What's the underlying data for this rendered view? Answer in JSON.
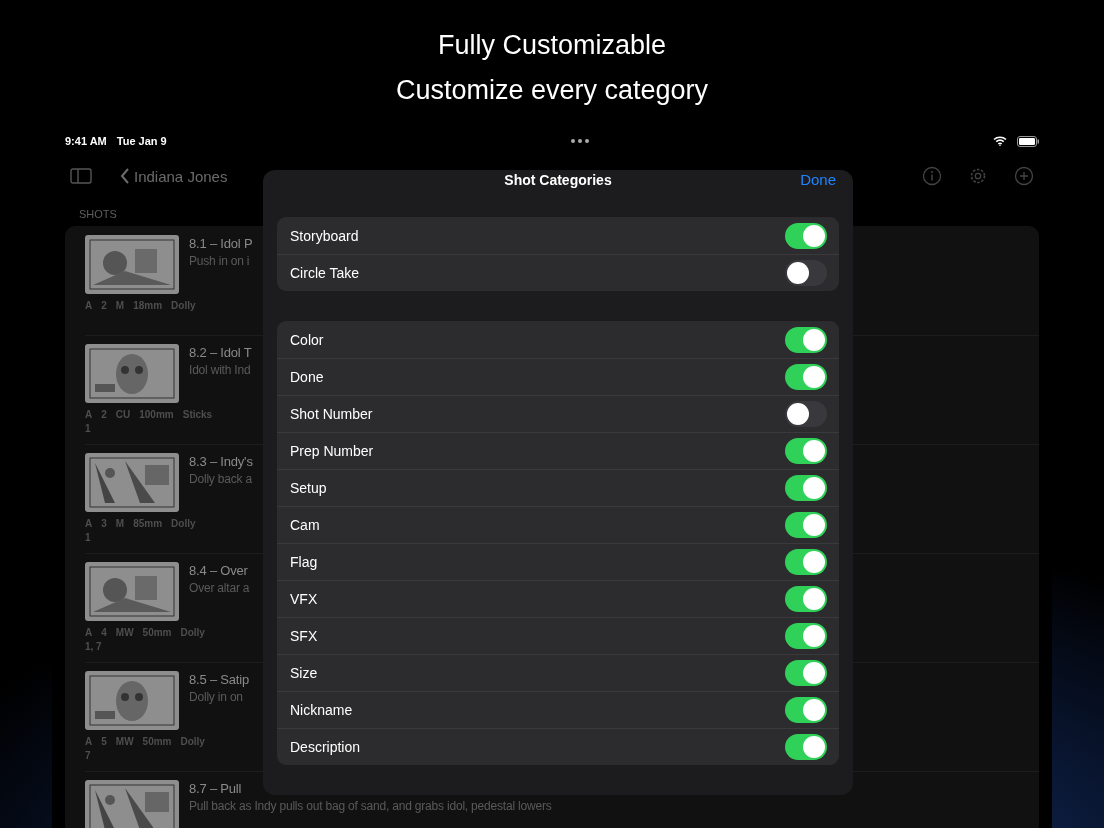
{
  "header": {
    "title": "Fully Customizable",
    "subtitle": "Customize every category"
  },
  "status_bar": {
    "time": "9:41 AM",
    "date": "Tue Jan 9"
  },
  "nav": {
    "back": "Indiana Jones"
  },
  "section": "SHOTS",
  "shots": [
    {
      "title": "8.1 – Idol P",
      "description": "Push in on i",
      "meta": [
        "A",
        "2",
        "M",
        "18mm",
        "Dolly"
      ]
    },
    {
      "title": "8.2 – Idol T",
      "description": "Idol with Ind",
      "meta": [
        "A",
        "2",
        "CU",
        "100mm",
        "Sticks"
      ],
      "extra": "1"
    },
    {
      "title": "8.3 – Indy's",
      "description": "Dolly back a",
      "meta": [
        "A",
        "3",
        "M",
        "85mm",
        "Dolly"
      ],
      "extra": "1"
    },
    {
      "title": "8.4 – Over",
      "description": "Over altar a",
      "meta": [
        "A",
        "4",
        "MW",
        "50mm",
        "Dolly"
      ],
      "extra": "1, 7"
    },
    {
      "title": "8.5 – Satip",
      "description": "Dolly in on",
      "meta": [
        "A",
        "5",
        "MW",
        "50mm",
        "Dolly"
      ],
      "extra": "7"
    },
    {
      "title": "8.7 – Pull",
      "description": "Pull back as Indy pulls out bag of sand, and grabs idol, pedestal lowers"
    }
  ],
  "sheet": {
    "title": "Shot Categories",
    "done": "Done",
    "groups": [
      [
        {
          "label": "Storyboard",
          "on": true
        },
        {
          "label": "Circle Take",
          "on": false
        }
      ],
      [
        {
          "label": "Color",
          "on": true
        },
        {
          "label": "Done",
          "on": true
        },
        {
          "label": "Shot Number",
          "on": false
        },
        {
          "label": "Prep Number",
          "on": true
        },
        {
          "label": "Setup",
          "on": true
        },
        {
          "label": "Cam",
          "on": true
        },
        {
          "label": "Flag",
          "on": true
        },
        {
          "label": "VFX",
          "on": true
        },
        {
          "label": "SFX",
          "on": true
        },
        {
          "label": "Size",
          "on": true
        },
        {
          "label": "Nickname",
          "on": true
        },
        {
          "label": "Description",
          "on": true
        }
      ]
    ]
  }
}
